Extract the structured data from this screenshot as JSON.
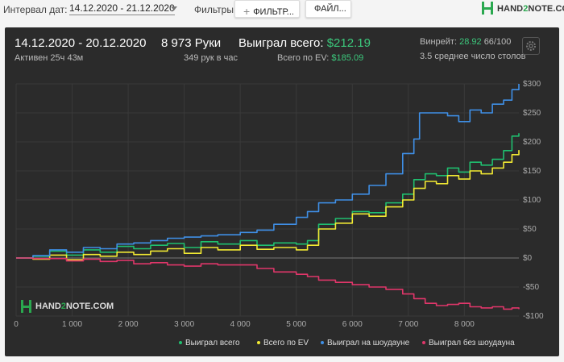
{
  "topbar": {
    "interval_label": "Интервал дат:",
    "date_range": "14.12.2020 - 21.12.2020",
    "filters_label": "Фильтры:",
    "filter_button": "ФИЛЬТР...",
    "file_button": "ФАЙЛ...",
    "logo_prefix": "HAND",
    "logo_num": "2",
    "logo_suffix": "NOTE.COM"
  },
  "stats": {
    "period": "14.12.2020 - 20.12.2020",
    "active": "Активен 25ч 43м",
    "hands": "8 973 Руки",
    "hands_per_hour": "349 рук в час",
    "won_label": "Выиграл всего:",
    "won_value": "$212.19",
    "ev_label": "Всего по EV:",
    "ev_value": "$185.09",
    "winrate_label": "Винрейт:",
    "winrate_value": "28.92",
    "winrate_rest": "66/100",
    "tables": "3.5 среднее число столов"
  },
  "colors": {
    "won_total": "#1fbf6f",
    "ev_total": "#f2ea33",
    "showdown": "#3f8fe6",
    "no_showdown": "#e0366a",
    "background": "#2b2b2b",
    "accent_green": "#3cc87c"
  },
  "watermark": {
    "prefix": "HAND",
    "num": "2",
    "suffix": "NOTE.COM"
  },
  "chart_data": {
    "type": "line",
    "xlabel": "",
    "ylabel": "",
    "xlim": [
      0,
      8973
    ],
    "ylim": [
      -100,
      300
    ],
    "x_ticks": [
      0,
      1000,
      2000,
      3000,
      4000,
      5000,
      6000,
      7000,
      8000
    ],
    "x_tick_labels": [
      "0",
      "1 000",
      "2 000",
      "3 000",
      "4 000",
      "5 000",
      "6 000",
      "7 000",
      "8 000"
    ],
    "y_ticks": [
      300,
      250,
      200,
      150,
      100,
      50,
      0,
      -50,
      -100
    ],
    "y_tick_labels": [
      "$300",
      "$250",
      "$200",
      "$150",
      "$100",
      "$50",
      "$0",
      "-$50",
      "-$100"
    ],
    "grid": true,
    "legend_position": "bottom-right",
    "series": [
      {
        "name": "Выиграл всего",
        "color": "#1fbf6f",
        "points": [
          [
            0,
            0
          ],
          [
            300,
            3
          ],
          [
            600,
            12
          ],
          [
            900,
            5
          ],
          [
            1200,
            14
          ],
          [
            1500,
            10
          ],
          [
            1800,
            20
          ],
          [
            2100,
            16
          ],
          [
            2400,
            22
          ],
          [
            2700,
            25
          ],
          [
            3000,
            18
          ],
          [
            3300,
            28
          ],
          [
            3600,
            24
          ],
          [
            4000,
            30
          ],
          [
            4300,
            22
          ],
          [
            4600,
            26
          ],
          [
            5000,
            24
          ],
          [
            5200,
            30
          ],
          [
            5400,
            58
          ],
          [
            5700,
            68
          ],
          [
            6000,
            80
          ],
          [
            6300,
            78
          ],
          [
            6600,
            95
          ],
          [
            6900,
            110
          ],
          [
            7100,
            135
          ],
          [
            7300,
            145
          ],
          [
            7500,
            142
          ],
          [
            7700,
            155
          ],
          [
            7900,
            148
          ],
          [
            8100,
            165
          ],
          [
            8300,
            160
          ],
          [
            8500,
            170
          ],
          [
            8700,
            185
          ],
          [
            8850,
            210
          ],
          [
            8973,
            215
          ]
        ]
      },
      {
        "name": "Всего по EV",
        "color": "#f2ea33",
        "points": [
          [
            0,
            0
          ],
          [
            300,
            -2
          ],
          [
            600,
            5
          ],
          [
            900,
            -3
          ],
          [
            1200,
            6
          ],
          [
            1500,
            3
          ],
          [
            1800,
            10
          ],
          [
            2100,
            6
          ],
          [
            2400,
            12
          ],
          [
            2700,
            16
          ],
          [
            3000,
            8
          ],
          [
            3300,
            18
          ],
          [
            3600,
            14
          ],
          [
            4000,
            22
          ],
          [
            4300,
            15
          ],
          [
            4600,
            18
          ],
          [
            5000,
            14
          ],
          [
            5200,
            22
          ],
          [
            5400,
            50
          ],
          [
            5700,
            60
          ],
          [
            6000,
            76
          ],
          [
            6300,
            72
          ],
          [
            6600,
            88
          ],
          [
            6900,
            100
          ],
          [
            7100,
            120
          ],
          [
            7300,
            132
          ],
          [
            7500,
            128
          ],
          [
            7700,
            142
          ],
          [
            7900,
            136
          ],
          [
            8100,
            150
          ],
          [
            8300,
            145
          ],
          [
            8500,
            155
          ],
          [
            8700,
            165
          ],
          [
            8850,
            178
          ],
          [
            8973,
            186
          ]
        ]
      },
      {
        "name": "Выиграл на шоудауне",
        "color": "#3f8fe6",
        "points": [
          [
            0,
            0
          ],
          [
            300,
            4
          ],
          [
            600,
            14
          ],
          [
            900,
            10
          ],
          [
            1200,
            18
          ],
          [
            1500,
            16
          ],
          [
            1800,
            24
          ],
          [
            2100,
            26
          ],
          [
            2400,
            30
          ],
          [
            2700,
            34
          ],
          [
            3000,
            36
          ],
          [
            3300,
            38
          ],
          [
            3600,
            40
          ],
          [
            4000,
            44
          ],
          [
            4300,
            48
          ],
          [
            4600,
            58
          ],
          [
            5000,
            70
          ],
          [
            5200,
            80
          ],
          [
            5400,
            95
          ],
          [
            5700,
            100
          ],
          [
            6000,
            110
          ],
          [
            6300,
            125
          ],
          [
            6600,
            145
          ],
          [
            6900,
            180
          ],
          [
            7100,
            205
          ],
          [
            7200,
            250
          ],
          [
            7500,
            250
          ],
          [
            7700,
            245
          ],
          [
            7900,
            235
          ],
          [
            8100,
            255
          ],
          [
            8300,
            250
          ],
          [
            8500,
            265
          ],
          [
            8700,
            272
          ],
          [
            8850,
            290
          ],
          [
            8973,
            300
          ]
        ]
      },
      {
        "name": "Выиграл без шоудауна",
        "color": "#e0366a",
        "points": [
          [
            0,
            0
          ],
          [
            300,
            -1
          ],
          [
            600,
            -1
          ],
          [
            900,
            -5
          ],
          [
            1200,
            -2
          ],
          [
            1500,
            -6
          ],
          [
            1800,
            -4
          ],
          [
            2100,
            -10
          ],
          [
            2400,
            -8
          ],
          [
            2700,
            -12
          ],
          [
            3000,
            -14
          ],
          [
            3300,
            -10
          ],
          [
            3600,
            -12
          ],
          [
            4000,
            -12
          ],
          [
            4300,
            -18
          ],
          [
            4600,
            -24
          ],
          [
            5000,
            -28
          ],
          [
            5200,
            -32
          ],
          [
            5400,
            -38
          ],
          [
            5700,
            -42
          ],
          [
            6000,
            -46
          ],
          [
            6300,
            -50
          ],
          [
            6600,
            -54
          ],
          [
            6900,
            -62
          ],
          [
            7100,
            -70
          ],
          [
            7300,
            -78
          ],
          [
            7500,
            -82
          ],
          [
            7700,
            -80
          ],
          [
            7900,
            -78
          ],
          [
            8100,
            -84
          ],
          [
            8300,
            -86
          ],
          [
            8500,
            -84
          ],
          [
            8700,
            -88
          ],
          [
            8850,
            -86
          ],
          [
            8973,
            -88
          ]
        ]
      }
    ]
  }
}
